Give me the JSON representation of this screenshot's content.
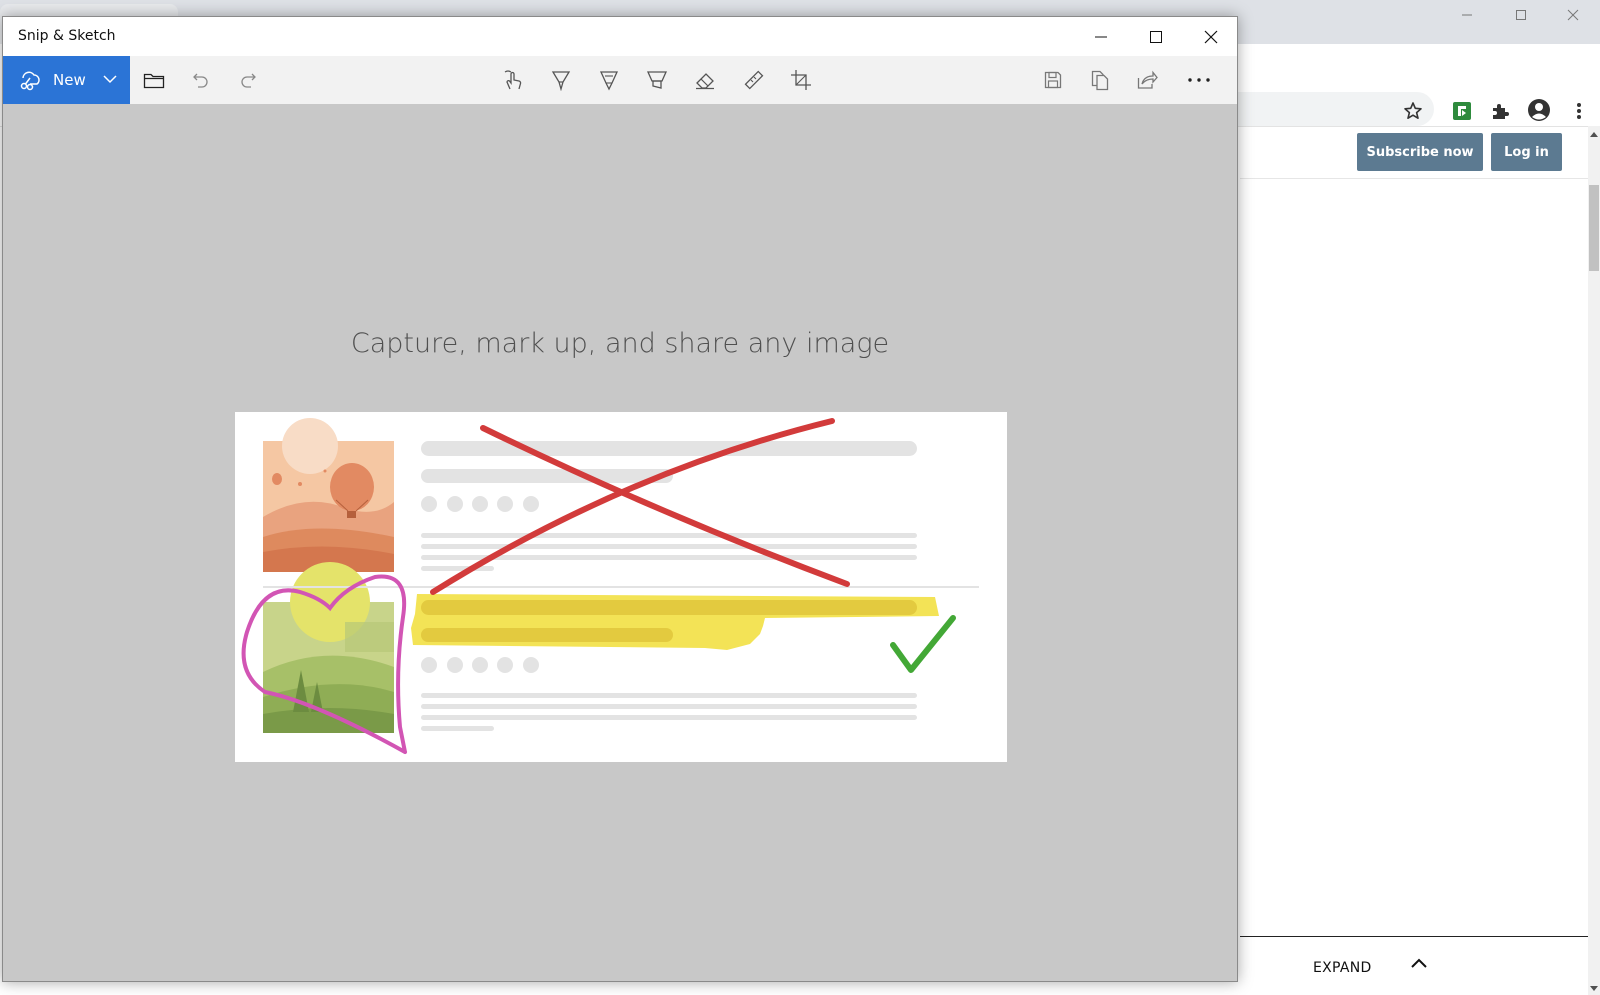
{
  "browser": {
    "subscribe_label": "Subscribe now",
    "login_label": "Log in",
    "expand_label": "EXPAND",
    "icons": [
      "minimize-icon",
      "maximize-icon",
      "close-icon",
      "star-icon",
      "extension-green-icon",
      "puzzle-icon",
      "profile-icon",
      "kebab-menu-icon",
      "chevron-up-icon"
    ],
    "button_color": "#5c7a91"
  },
  "snip": {
    "title": "Snip & Sketch",
    "new_label": "New",
    "headline": "Capture, mark up, and share any image",
    "accent_color": "#2b74d6",
    "toolbar_icons": [
      "open-folder-icon",
      "undo-icon",
      "redo-icon",
      "touch-writing-icon",
      "ballpoint-pen-icon",
      "pencil-icon",
      "highlighter-icon",
      "eraser-icon",
      "ruler-icon",
      "crop-icon",
      "save-icon",
      "copy-icon",
      "share-icon",
      "more-icon"
    ]
  }
}
